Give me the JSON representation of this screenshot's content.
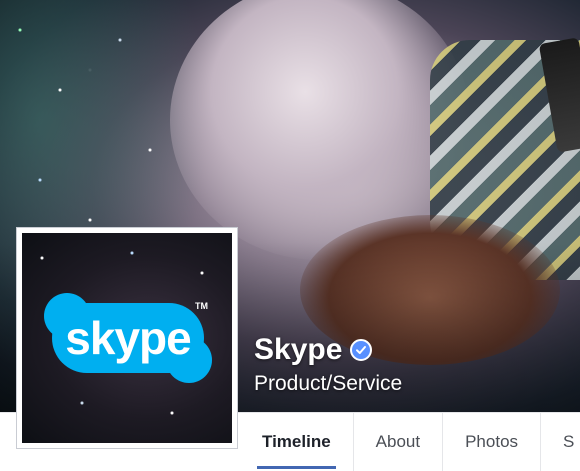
{
  "profile": {
    "name": "Skype",
    "category": "Product/Service",
    "verified": true
  },
  "avatar": {
    "logo_text": "skype",
    "logo_trademark": "TM",
    "logo_color": "#00aff0"
  },
  "tabs": [
    {
      "label": "Timeline",
      "active": true
    },
    {
      "label": "About",
      "active": false
    },
    {
      "label": "Photos",
      "active": false
    },
    {
      "label": "S",
      "active": false
    }
  ],
  "colors": {
    "verified_badge": "#5890ff",
    "active_tab_underline": "#4267b2"
  }
}
